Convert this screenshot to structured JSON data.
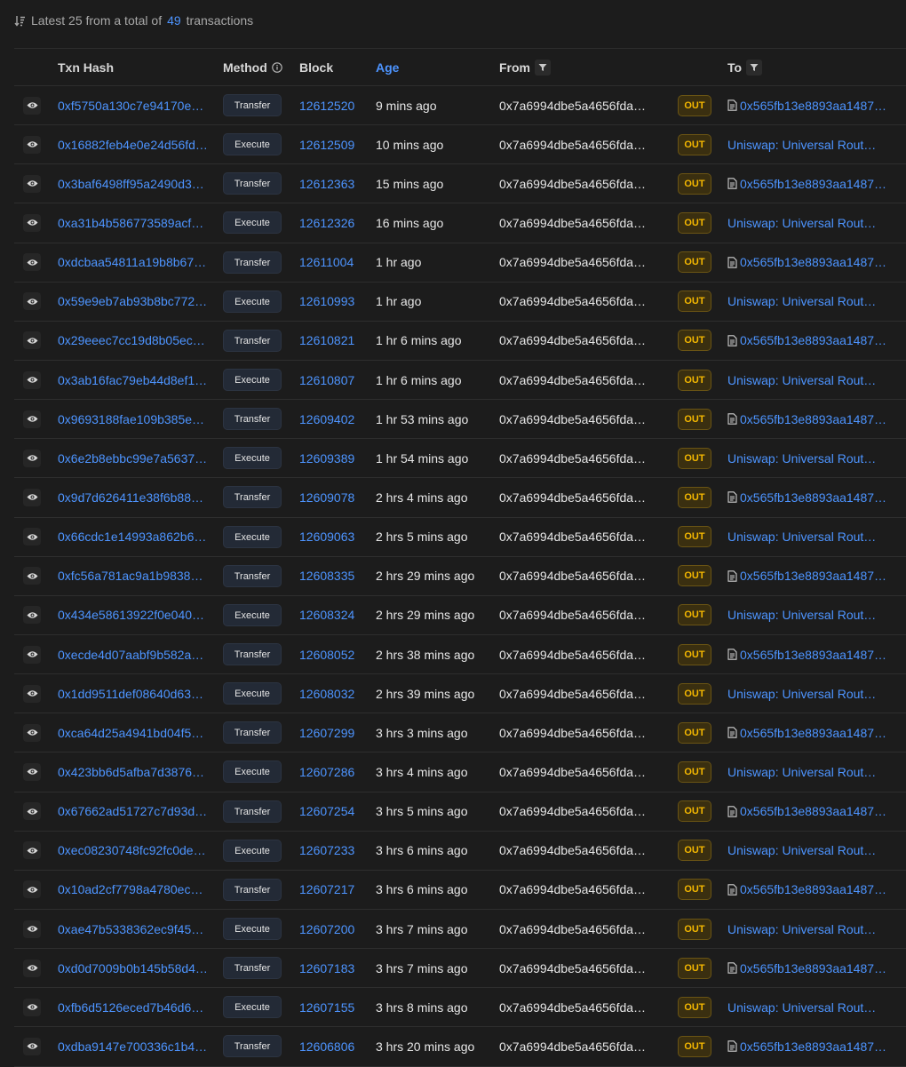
{
  "summary": {
    "prefix": "Latest 25 from a total of",
    "total": "49",
    "suffix": "transactions"
  },
  "headers": {
    "txn_hash": "Txn Hash",
    "method": "Method",
    "block": "Block",
    "age": "Age",
    "from": "From",
    "to": "To"
  },
  "rows": [
    {
      "hash": "0xf5750a130c7e94170e…",
      "method": "Transfer",
      "block": "12612520",
      "age": "9 mins ago",
      "from": "0x7a6994dbe5a4656fda…",
      "dir": "OUT",
      "to": "0x565fb13e8893aa1487…",
      "to_contract": true
    },
    {
      "hash": "0x16882feb4e0e24d56fd…",
      "method": "Execute",
      "block": "12612509",
      "age": "10 mins ago",
      "from": "0x7a6994dbe5a4656fda…",
      "dir": "OUT",
      "to": "Uniswap: Universal Rout…",
      "to_contract": false
    },
    {
      "hash": "0x3baf6498ff95a2490d3…",
      "method": "Transfer",
      "block": "12612363",
      "age": "15 mins ago",
      "from": "0x7a6994dbe5a4656fda…",
      "dir": "OUT",
      "to": "0x565fb13e8893aa1487…",
      "to_contract": true
    },
    {
      "hash": "0xa31b4b586773589acf…",
      "method": "Execute",
      "block": "12612326",
      "age": "16 mins ago",
      "from": "0x7a6994dbe5a4656fda…",
      "dir": "OUT",
      "to": "Uniswap: Universal Rout…",
      "to_contract": false
    },
    {
      "hash": "0xdcbaa54811a19b8b67…",
      "method": "Transfer",
      "block": "12611004",
      "age": "1 hr ago",
      "from": "0x7a6994dbe5a4656fda…",
      "dir": "OUT",
      "to": "0x565fb13e8893aa1487…",
      "to_contract": true
    },
    {
      "hash": "0x59e9eb7ab93b8bc772…",
      "method": "Execute",
      "block": "12610993",
      "age": "1 hr ago",
      "from": "0x7a6994dbe5a4656fda…",
      "dir": "OUT",
      "to": "Uniswap: Universal Rout…",
      "to_contract": false
    },
    {
      "hash": "0x29eeec7cc19d8b05ec…",
      "method": "Transfer",
      "block": "12610821",
      "age": "1 hr 6 mins ago",
      "from": "0x7a6994dbe5a4656fda…",
      "dir": "OUT",
      "to": "0x565fb13e8893aa1487…",
      "to_contract": true
    },
    {
      "hash": "0x3ab16fac79eb44d8ef1…",
      "method": "Execute",
      "block": "12610807",
      "age": "1 hr 6 mins ago",
      "from": "0x7a6994dbe5a4656fda…",
      "dir": "OUT",
      "to": "Uniswap: Universal Rout…",
      "to_contract": false
    },
    {
      "hash": "0x9693188fae109b385e…",
      "method": "Transfer",
      "block": "12609402",
      "age": "1 hr 53 mins ago",
      "from": "0x7a6994dbe5a4656fda…",
      "dir": "OUT",
      "to": "0x565fb13e8893aa1487…",
      "to_contract": true
    },
    {
      "hash": "0x6e2b8ebbc99e7a5637…",
      "method": "Execute",
      "block": "12609389",
      "age": "1 hr 54 mins ago",
      "from": "0x7a6994dbe5a4656fda…",
      "dir": "OUT",
      "to": "Uniswap: Universal Rout…",
      "to_contract": false
    },
    {
      "hash": "0x9d7d626411e38f6b88…",
      "method": "Transfer",
      "block": "12609078",
      "age": "2 hrs 4 mins ago",
      "from": "0x7a6994dbe5a4656fda…",
      "dir": "OUT",
      "to": "0x565fb13e8893aa1487…",
      "to_contract": true
    },
    {
      "hash": "0x66cdc1e14993a862b6…",
      "method": "Execute",
      "block": "12609063",
      "age": "2 hrs 5 mins ago",
      "from": "0x7a6994dbe5a4656fda…",
      "dir": "OUT",
      "to": "Uniswap: Universal Rout…",
      "to_contract": false
    },
    {
      "hash": "0xfc56a781ac9a1b9838…",
      "method": "Transfer",
      "block": "12608335",
      "age": "2 hrs 29 mins ago",
      "from": "0x7a6994dbe5a4656fda…",
      "dir": "OUT",
      "to": "0x565fb13e8893aa1487…",
      "to_contract": true
    },
    {
      "hash": "0x434e58613922f0e040…",
      "method": "Execute",
      "block": "12608324",
      "age": "2 hrs 29 mins ago",
      "from": "0x7a6994dbe5a4656fda…",
      "dir": "OUT",
      "to": "Uniswap: Universal Rout…",
      "to_contract": false
    },
    {
      "hash": "0xecde4d07aabf9b582a…",
      "method": "Transfer",
      "block": "12608052",
      "age": "2 hrs 38 mins ago",
      "from": "0x7a6994dbe5a4656fda…",
      "dir": "OUT",
      "to": "0x565fb13e8893aa1487…",
      "to_contract": true
    },
    {
      "hash": "0x1dd9511def08640d63…",
      "method": "Execute",
      "block": "12608032",
      "age": "2 hrs 39 mins ago",
      "from": "0x7a6994dbe5a4656fda…",
      "dir": "OUT",
      "to": "Uniswap: Universal Rout…",
      "to_contract": false
    },
    {
      "hash": "0xca64d25a4941bd04f5…",
      "method": "Transfer",
      "block": "12607299",
      "age": "3 hrs 3 mins ago",
      "from": "0x7a6994dbe5a4656fda…",
      "dir": "OUT",
      "to": "0x565fb13e8893aa1487…",
      "to_contract": true
    },
    {
      "hash": "0x423bb6d5afba7d3876…",
      "method": "Execute",
      "block": "12607286",
      "age": "3 hrs 4 mins ago",
      "from": "0x7a6994dbe5a4656fda…",
      "dir": "OUT",
      "to": "Uniswap: Universal Rout…",
      "to_contract": false
    },
    {
      "hash": "0x67662ad51727c7d93d…",
      "method": "Transfer",
      "block": "12607254",
      "age": "3 hrs 5 mins ago",
      "from": "0x7a6994dbe5a4656fda…",
      "dir": "OUT",
      "to": "0x565fb13e8893aa1487…",
      "to_contract": true
    },
    {
      "hash": "0xec08230748fc92fc0de…",
      "method": "Execute",
      "block": "12607233",
      "age": "3 hrs 6 mins ago",
      "from": "0x7a6994dbe5a4656fda…",
      "dir": "OUT",
      "to": "Uniswap: Universal Rout…",
      "to_contract": false
    },
    {
      "hash": "0x10ad2cf7798a4780ec…",
      "method": "Transfer",
      "block": "12607217",
      "age": "3 hrs 6 mins ago",
      "from": "0x7a6994dbe5a4656fda…",
      "dir": "OUT",
      "to": "0x565fb13e8893aa1487…",
      "to_contract": true
    },
    {
      "hash": "0xae47b5338362ec9f45…",
      "method": "Execute",
      "block": "12607200",
      "age": "3 hrs 7 mins ago",
      "from": "0x7a6994dbe5a4656fda…",
      "dir": "OUT",
      "to": "Uniswap: Universal Rout…",
      "to_contract": false
    },
    {
      "hash": "0xd0d7009b0b145b58d4…",
      "method": "Transfer",
      "block": "12607183",
      "age": "3 hrs 7 mins ago",
      "from": "0x7a6994dbe5a4656fda…",
      "dir": "OUT",
      "to": "0x565fb13e8893aa1487…",
      "to_contract": true
    },
    {
      "hash": "0xfb6d5126eced7b46d6…",
      "method": "Execute",
      "block": "12607155",
      "age": "3 hrs 8 mins ago",
      "from": "0x7a6994dbe5a4656fda…",
      "dir": "OUT",
      "to": "Uniswap: Universal Rout…",
      "to_contract": false
    },
    {
      "hash": "0xdba9147e700336c1b4…",
      "method": "Transfer",
      "block": "12606806",
      "age": "3 hrs 20 mins ago",
      "from": "0x7a6994dbe5a4656fda…",
      "dir": "OUT",
      "to": "0x565fb13e8893aa1487…",
      "to_contract": true
    }
  ],
  "icons": {
    "sort": "sort-descending-icon",
    "info": "info-circle-icon",
    "filter": "filter-icon",
    "eye": "eye-icon",
    "contract": "document-icon"
  },
  "colors": {
    "background": "#1c1c1c",
    "link": "#4d94ff",
    "out_badge_text": "#f5b800",
    "out_badge_bg": "#3a2f10",
    "method_badge_bg": "#232a36"
  }
}
